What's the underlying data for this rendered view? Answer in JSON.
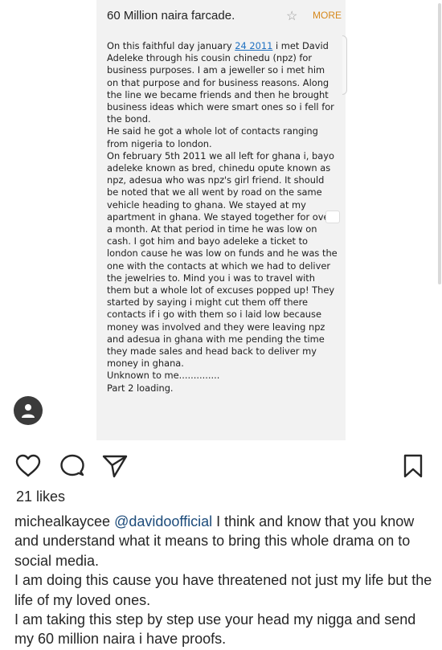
{
  "note": {
    "title": "60 Million naira farcade.",
    "more_label": "MORE",
    "star_icon": "star-outline-icon",
    "body_before_link": "On this faithful day january ",
    "body_link": "24 2011",
    "body_after_link": " i met David Adeleke through his cousin chinedu (npz) for business purposes. I am a jeweller so i met him on that purpose and for business reasons. Along the line we became friends and then he brought business ideas which were smart ones so i fell for the bond.\nHe said he got a whole lot of contacts ranging from nigeria to london.\nOn february 5th 2011 we all left for ghana i, bayo adeleke known as bred, chinedu opute known as npz, adesua who was npz's girl friend. It should be noted that we all went by road on the same vehicle heading to ghana. We stayed at my apartment in ghana. We stayed together for over a month. At that period in time he was low on cash. I got him and bayo adeleke a ticket to london cause he was low on funds and he was the one with the contacts at which we had to deliver the jewelries to. Mind you i was to travel with them but a whole lot of excuses popped up! They started by saying i might cut them off there contacts if i go with them so i laid low because money was involved and they were leaving npz and adesua in ghana with me pending the time they made sales and head back to deliver my money in ghana.\nUnknown to me..............\nPart 2 loading."
  },
  "post": {
    "likes": "21 likes",
    "username": "michealkaycee",
    "mention": "@davidoofficial",
    "caption_first": " I think and know that you know and understand what it means to bring this whole drama on to social media.",
    "caption_lines": [
      "I am doing this cause you have threatened not just my life but the life of my loved ones.",
      "I am taking this step by step use your head my nigga and send my 60 million naira i have proofs."
    ]
  },
  "icons": {
    "like": "heart-icon",
    "comment": "comment-icon",
    "share": "send-icon",
    "save": "bookmark-icon",
    "tagged": "person-icon"
  }
}
